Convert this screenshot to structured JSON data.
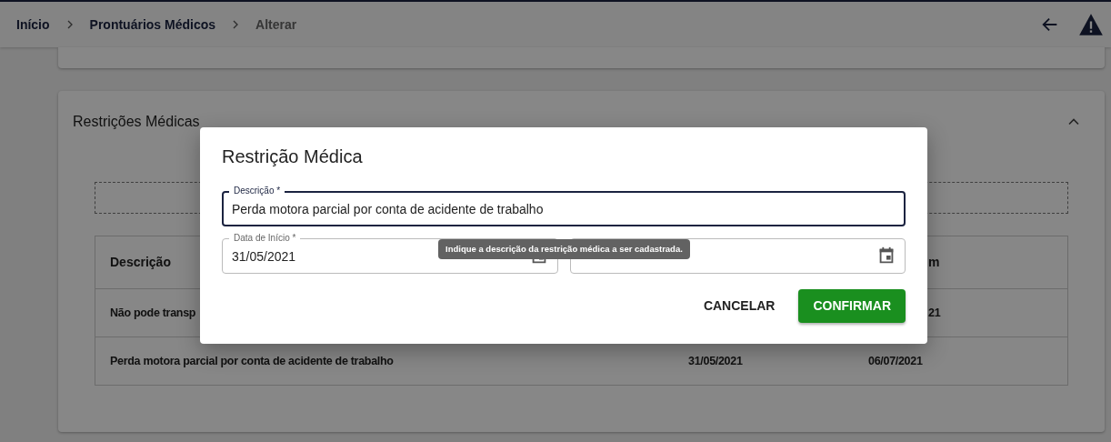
{
  "breadcrumb": [
    {
      "label": "Início",
      "current": false
    },
    {
      "label": "Prontuários Médicos",
      "current": false
    },
    {
      "label": "Alterar",
      "current": true
    }
  ],
  "section": {
    "title": "Restrições Médicas",
    "expanded": true
  },
  "table": {
    "columns": [
      "Descrição",
      "m"
    ],
    "rows": [
      {
        "cells": [
          "Não pode transp",
          "21"
        ]
      },
      {
        "cells": [
          "Perda motora parcial por conta de acidente de trabalho",
          "31/05/2021",
          "06/07/2021"
        ]
      }
    ]
  },
  "dialog": {
    "title": "Restrição Médica",
    "fields": [
      {
        "label": "Descrição *",
        "value": "Perda motora parcial por conta de acidente de trabalho",
        "focused": true
      },
      {
        "label": "Data de Início *",
        "value": "31/05/2021",
        "focused": false
      },
      {
        "focused": false
      }
    ],
    "tooltip": "Indique a descrição da restrição médica a ser cadastrada.",
    "buttons": [
      {
        "label": "CANCELAR",
        "kind": "text"
      },
      {
        "label": "CONFIRMAR",
        "kind": "primary"
      }
    ]
  }
}
